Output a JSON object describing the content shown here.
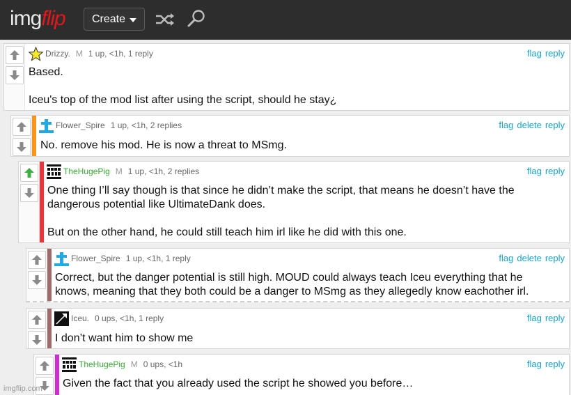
{
  "header": {
    "logo_part1": "img",
    "logo_part2": "flip",
    "create_label": "Create",
    "shuffle_icon": "shuffle-icon",
    "search_icon": "search-icon"
  },
  "colors": {
    "header_bg": "#2d2d2d",
    "link": "#18a3c7",
    "upvoted": "#3cb043",
    "bar_orange": "#f7941d",
    "bar_red": "#ee3438",
    "bar_brown": "#9e6a6a",
    "bar_magenta": "#cc2ecf"
  },
  "comments": [
    {
      "user": "Drizzy.",
      "mod": "M",
      "meta": "1 up, <1h, 1 reply",
      "actions": [
        "flag",
        "reply"
      ],
      "lines": [
        "Based.",
        "Iceu's top of the mod list after using the script, should he stay¿"
      ]
    },
    {
      "user": "Flower_Spire",
      "mod": "",
      "meta": "1 up, <1h, 2 replies",
      "actions": [
        "flag",
        "delete",
        "reply"
      ],
      "lines": [
        "No. remove his mod. He is now a threat to MSmg."
      ]
    },
    {
      "user": "TheHugePig",
      "mod": "M",
      "meta": "1 up, <1h, 2 replies",
      "actions": [
        "flag",
        "reply"
      ],
      "lines": [
        "One thing I’ll say though is that since he didn’t make the script, that means he doesn’t have the\ndangerous potential like UltimateDank does.",
        "But on the other hand, he could still teach him irl like he did with this one."
      ]
    },
    {
      "user": "Flower_Spire",
      "mod": "",
      "meta": "1 up, <1h, 1 reply",
      "actions": [
        "flag",
        "delete",
        "reply"
      ],
      "lines": [
        "Correct, but the danger potential is still high. MOUD could always teach Iceu everything that he\nknows, meaning that they both could be a danger to MSmg as they allegedly know eachother irl."
      ]
    },
    {
      "user": "Iceu.",
      "mod": "",
      "meta": "0 ups, <1h, 1 reply",
      "actions": [
        "flag",
        "reply"
      ],
      "lines": [
        "I don’t want him to show me"
      ]
    },
    {
      "user": "TheHugePig",
      "mod": "M",
      "meta": "0 ups, <1h",
      "actions": [
        "flag",
        "reply"
      ],
      "lines": [
        "Given the fact that you already used the script he showed you before…"
      ]
    }
  ],
  "watermark": "imgflip.com"
}
